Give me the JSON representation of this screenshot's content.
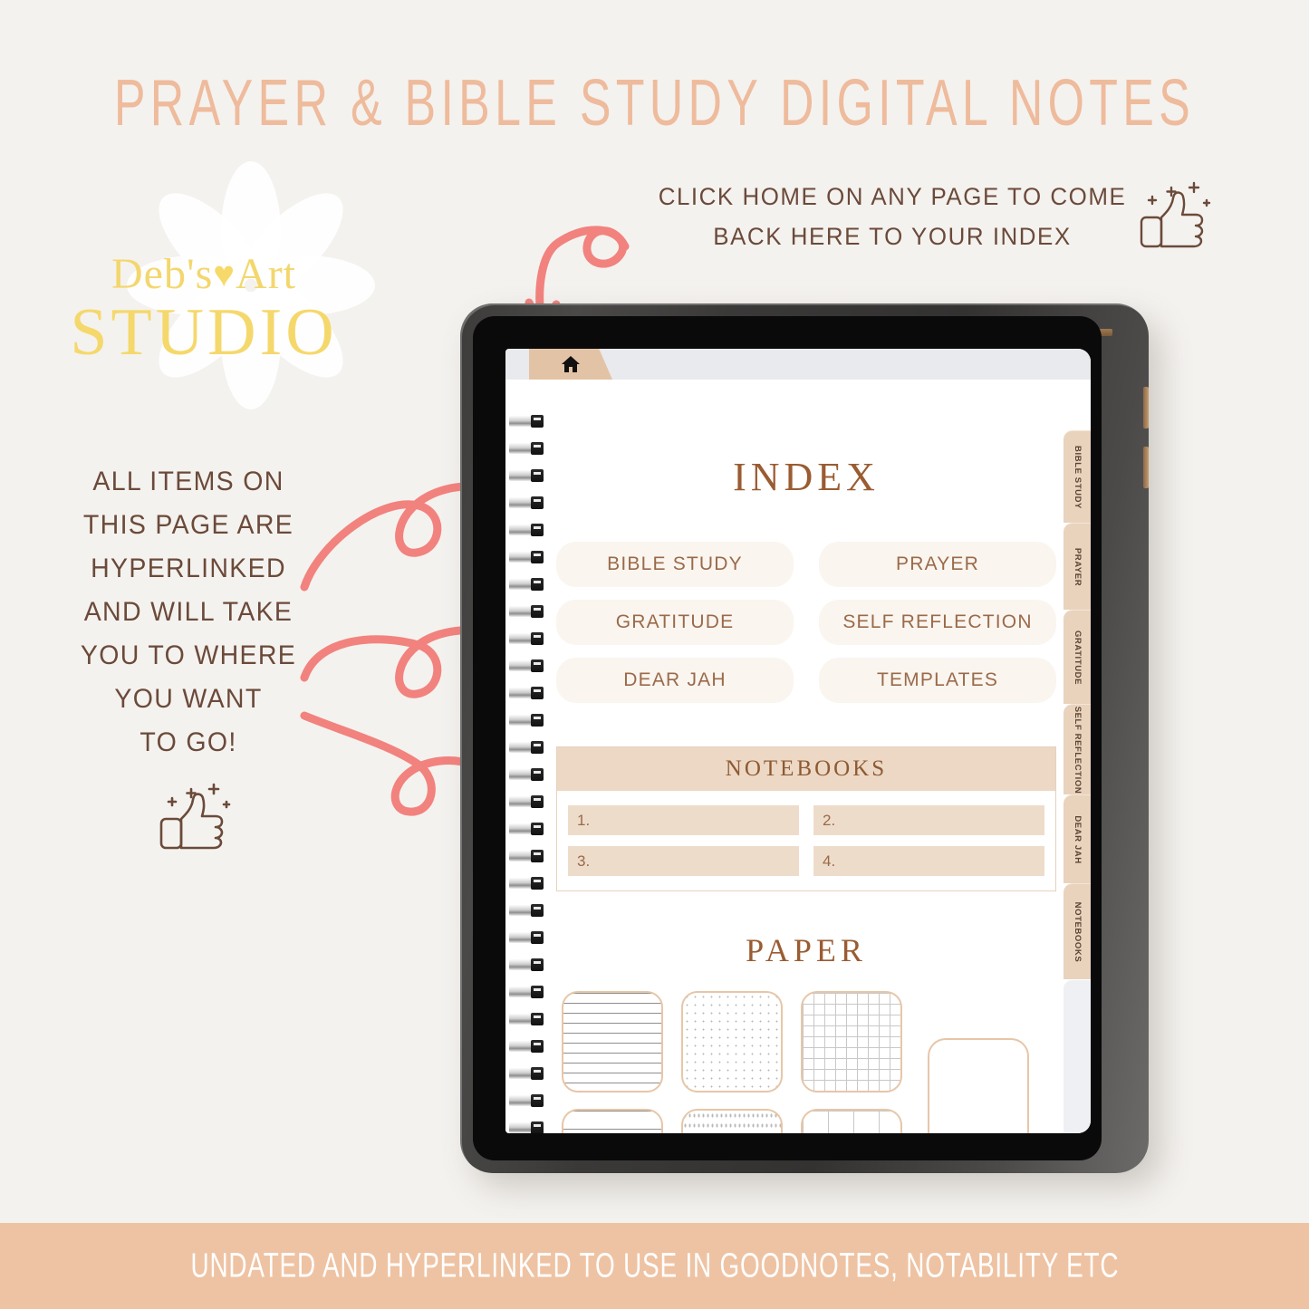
{
  "header": {
    "title": "PRAYER & BIBLE STUDY DIGITAL NOTES",
    "title_color": "#eebb9c"
  },
  "logo": {
    "line1_before": "Deb's",
    "heart": "♥",
    "line1_after": "Art",
    "line2": "STUDIO",
    "color": "#f3d76e",
    "flower_icon": "daisy-icon"
  },
  "callouts": {
    "home": {
      "line1": "CLICK HOME ON ANY PAGE TO COME",
      "line2": "BACK HERE TO YOUR INDEX",
      "icon": "thumbs-up-sparkle-icon"
    },
    "links": {
      "lines": [
        "ALL ITEMS ON",
        "THIS PAGE ARE",
        "HYPERLINKED",
        "AND WILL TAKE",
        "YOU TO WHERE",
        "YOU WANT",
        "TO GO!"
      ],
      "icon": "thumbs-up-sparkle-icon"
    },
    "text_color": "#6b4a3a",
    "arrow_color": "#f2827e"
  },
  "device": {
    "type": "tablet-mockup",
    "bezel_color": "#3a3938",
    "home_tab_icon": "home-icon",
    "home_tab_color": "#e3c3a6"
  },
  "page": {
    "index_title": "INDEX",
    "index_buttons": [
      {
        "label": "BIBLE STUDY"
      },
      {
        "label": "PRAYER"
      },
      {
        "label": "GRATITUDE"
      },
      {
        "label": "SELF REFLECTION"
      },
      {
        "label": "DEAR JAH"
      },
      {
        "label": "TEMPLATES"
      }
    ],
    "notebooks_title": "NOTEBOOKS",
    "notebook_slots": [
      "1.",
      "2.",
      "3.",
      "4."
    ],
    "paper_title": "PAPER",
    "paper_thumbs": [
      {
        "name": "lined-narrow"
      },
      {
        "name": "dotted-narrow"
      },
      {
        "name": "grid-narrow"
      },
      {
        "name": "lined-wide"
      },
      {
        "name": "dotted-wide"
      },
      {
        "name": "grid-wide"
      },
      {
        "name": "blank"
      }
    ],
    "accent_brown": "#9a5c31",
    "button_bg": "#faf5ef",
    "notebooks_bg": "#ecd8c5"
  },
  "side_tabs": [
    {
      "label": "BIBLE STUDY"
    },
    {
      "label": "PRAYER"
    },
    {
      "label": "GRATITUDE"
    },
    {
      "label": "SELF REFLECTION"
    },
    {
      "label": "DEAR JAH"
    },
    {
      "label": "NOTEBOOKS"
    }
  ],
  "footer": {
    "text": "UNDATED AND HYPERLINKED TO USE IN GOODNOTES, NOTABILITY ETC",
    "bg": "#eec3a3"
  }
}
